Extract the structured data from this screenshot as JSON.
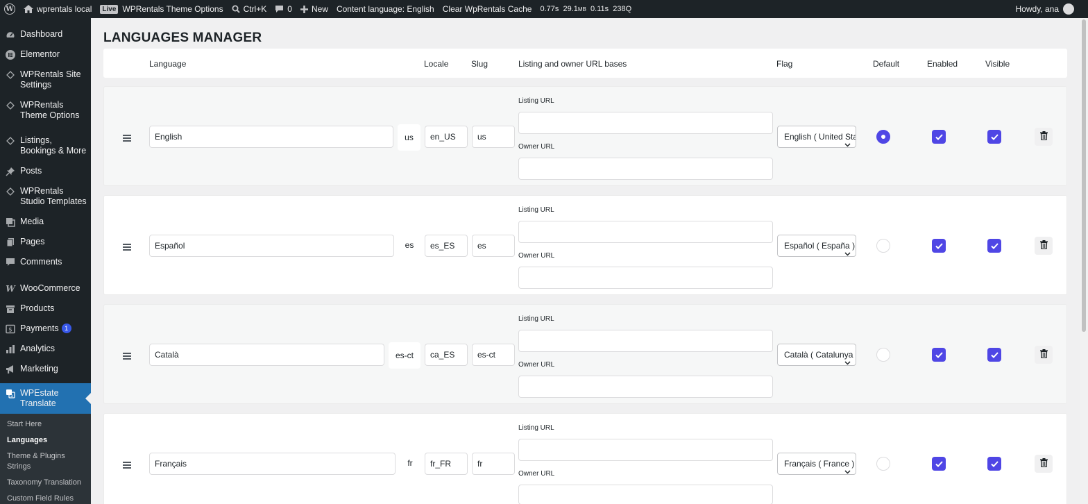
{
  "adminbar": {
    "site_name": "wprentals local",
    "live_badge": "Live",
    "theme_options": "WPRentals Theme Options",
    "command": "Ctrl+K",
    "comments_count": "0",
    "new_label": "New",
    "content_language": "Content language: English",
    "clear_cache": "Clear WpRentals Cache",
    "perf_time": "0.77s",
    "perf_mem_value": "29.1",
    "perf_mem_unit": "MB",
    "perf_query_time": "0.11s",
    "perf_queries": "238Q",
    "howdy": "Howdy, ana"
  },
  "sidebar": {
    "items": [
      {
        "label": "Dashboard",
        "icon": "dashboard-icon"
      },
      {
        "label": "Elementor",
        "icon": "elementor-icon"
      },
      {
        "label": "WPRentals Site Settings",
        "icon": "diamond-icon"
      },
      {
        "label": "WPRentals Theme Options",
        "icon": "diamond-icon"
      },
      {
        "label": "Listings, Bookings & More",
        "icon": "diamond-icon"
      },
      {
        "label": "Posts",
        "icon": "pin-icon"
      },
      {
        "label": "WPRentals Studio Templates",
        "icon": "diamond-icon"
      },
      {
        "label": "Media",
        "icon": "media-icon"
      },
      {
        "label": "Pages",
        "icon": "pages-icon"
      },
      {
        "label": "Comments",
        "icon": "comment-icon"
      },
      {
        "label": "WooCommerce",
        "icon": "woocommerce-icon"
      },
      {
        "label": "Products",
        "icon": "archive-icon"
      },
      {
        "label": "Payments",
        "icon": "dollar-icon",
        "badge": "1"
      },
      {
        "label": "Analytics",
        "icon": "bar-chart-icon"
      },
      {
        "label": "Marketing",
        "icon": "megaphone-icon"
      },
      {
        "label": "WPEstate Translate",
        "icon": "translate-icon"
      }
    ],
    "submenu": [
      "Start Here",
      "Languages",
      "Theme & Plugins Strings",
      "Taxonomy Translation",
      "Custom Field Rules"
    ]
  },
  "page": {
    "title": "LANGUAGES MANAGER",
    "headers": {
      "language": "Language",
      "locale": "Locale",
      "slug": "Slug",
      "url_bases": "Listing and owner URL bases",
      "flag": "Flag",
      "default": "Default",
      "enabled": "Enabled",
      "visible": "Visible"
    },
    "listing_url_label": "Listing URL",
    "owner_url_label": "Owner URL"
  },
  "languages": [
    {
      "name": "English",
      "code": "us",
      "locale": "en_US",
      "slug": "us",
      "listing_url": "",
      "owner_url": "",
      "flag": "English ( United States )",
      "default": true,
      "enabled": true,
      "visible": true
    },
    {
      "name": "Español",
      "code": "es",
      "locale": "es_ES",
      "slug": "es",
      "listing_url": "",
      "owner_url": "",
      "flag": "Español ( España )",
      "default": false,
      "enabled": true,
      "visible": true
    },
    {
      "name": "Català",
      "code": "es-ct",
      "locale": "ca_ES",
      "slug": "es-ct",
      "listing_url": "",
      "owner_url": "",
      "flag": "Català ( Catalunya )",
      "default": false,
      "enabled": true,
      "visible": true
    },
    {
      "name": "Français",
      "code": "fr",
      "locale": "fr_FR",
      "slug": "fr",
      "listing_url": "",
      "owner_url": "",
      "flag": "Français ( France )",
      "default": false,
      "enabled": true,
      "visible": true
    }
  ],
  "colors": {
    "accent": "#4f46e5",
    "sidebar_bg": "#1d2327",
    "sidebar_current": "#2271b1"
  }
}
